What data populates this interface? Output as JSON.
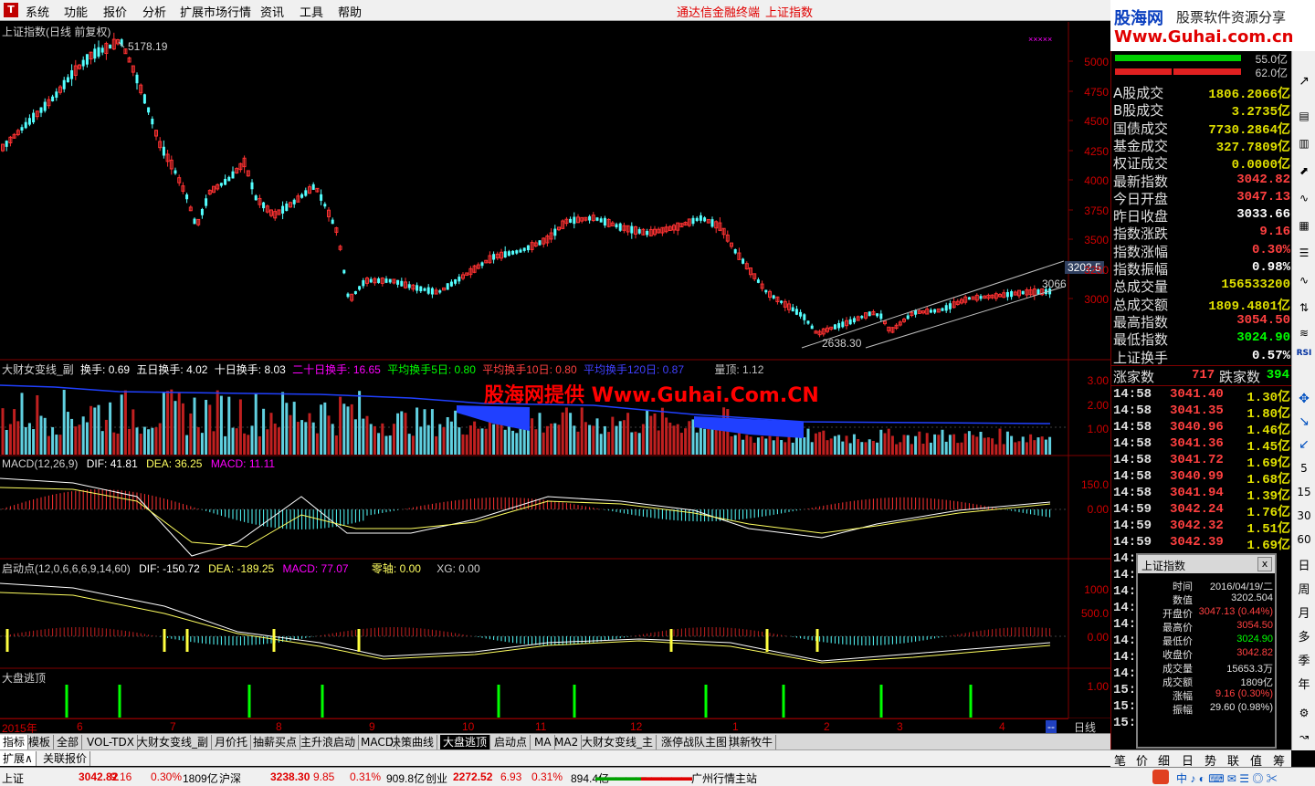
{
  "menu": {
    "logo": "T",
    "items": [
      "系统",
      "功能",
      "报价",
      "分析",
      "扩展市场行情",
      "资讯",
      "工具",
      "帮助"
    ],
    "title_terminal": "通达信金融终端",
    "title_index": "上证指数"
  },
  "brand": {
    "logo_text": "股海网",
    "slogan": "股票软件资源分享",
    "url": "Www.Guhai.com.cn"
  },
  "main_chart": {
    "title": "上证指数(日线 前复权)",
    "high_label": "5178.19",
    "low_label": "2638.30",
    "last_label": "3066",
    "cursor_price": "3202.5",
    "y_ticks": [
      "5000",
      "4750",
      "4500",
      "4250",
      "4000",
      "3750",
      "3500",
      "3250",
      "3000"
    ],
    "colors": {
      "up": "#ff3232",
      "down": "#54ffff",
      "channel": "#c0c0c0"
    }
  },
  "volume_panel": {
    "title": "大财女变线_副",
    "items": [
      {
        "label": "换手: 0.69",
        "color": "#ffffff"
      },
      {
        "label": "五日换手: 4.02",
        "color": "#ffffff"
      },
      {
        "label": "十日换手: 8.03",
        "color": "#ffffff"
      },
      {
        "label": "二十日换手: 16.65",
        "color": "#ff00ff"
      },
      {
        "label": "平均换手5日: 0.80",
        "color": "#00ff00"
      },
      {
        "label": "平均换手10日: 0.80",
        "color": "#ff4040"
      },
      {
        "label": "平均换手120日: 0.87",
        "color": "#4040ff"
      },
      {
        "label": "量顶: 1.12",
        "color": "#c0c0c0"
      }
    ],
    "y_ticks": [
      "3.00",
      "2.00",
      "1.00"
    ]
  },
  "watermark": "股海网提供 Www.Guhai.Com.CN",
  "macd_panel": {
    "title": "MACD(12,26,9)",
    "dif": "DIF: 41.81",
    "dea": "DEA: 36.25",
    "macd": "MACD: 11.11",
    "y_ticks": [
      "150.0",
      "0.00"
    ]
  },
  "qidong_panel": {
    "title": "启动点(12,0,6,6,6,9,14,60)",
    "dif": "DIF: -150.72",
    "dea": "DEA: -189.25",
    "macd": "MACD: 77.07",
    "zero": "零轴: 0.00",
    "xg": "XG: 0.00",
    "y_ticks": [
      "1000",
      "500.0",
      "0.00"
    ]
  },
  "escape_panel": {
    "title": "大盘逃顶",
    "y_ticks": [
      "1.00"
    ]
  },
  "x_axis": {
    "labels": [
      "2015年",
      "6",
      "7",
      "8",
      "9",
      "10",
      "11",
      "12",
      "1",
      "2",
      "3",
      "4"
    ],
    "corner": "--",
    "period_label": "日线"
  },
  "info_panel": {
    "bar_values": [
      "55.0亿",
      "62.0亿"
    ],
    "rows": [
      {
        "label": "A股成交",
        "value": "1806.2066亿",
        "color": "#e0e000"
      },
      {
        "label": "B股成交",
        "value": "3.2735亿",
        "color": "#e0e000"
      },
      {
        "label": "国债成交",
        "value": "7730.2864亿",
        "color": "#e0e000"
      },
      {
        "label": "基金成交",
        "value": "327.7809亿",
        "color": "#e0e000"
      },
      {
        "label": "权证成交",
        "value": "0.0000亿",
        "color": "#e0e000"
      },
      {
        "label": "最新指数",
        "value": "3042.82",
        "color": "#ff4040"
      },
      {
        "label": "今日开盘",
        "value": "3047.13",
        "color": "#ff4040"
      },
      {
        "label": "昨日收盘",
        "value": "3033.66",
        "color": "#ffffff"
      },
      {
        "label": "指数涨跌",
        "value": "9.16",
        "color": "#ff4040"
      },
      {
        "label": "指数涨幅",
        "value": "0.30%",
        "color": "#ff4040"
      },
      {
        "label": "指数振幅",
        "value": "0.98%",
        "color": "#ffffff"
      },
      {
        "label": "总成交量",
        "value": "156533200",
        "color": "#e0e000"
      },
      {
        "label": "总成交额",
        "value": "1809.4801亿",
        "color": "#e0e000"
      },
      {
        "label": "最高指数",
        "value": "3054.50",
        "color": "#ff4040"
      },
      {
        "label": "最低指数",
        "value": "3024.90",
        "color": "#00ff00"
      },
      {
        "label": "上证换手",
        "value": "0.57%",
        "color": "#ffffff"
      }
    ],
    "up_label": "涨家数",
    "up_count": "717",
    "down_label": "跌家数",
    "down_count": "394",
    "ticks": [
      {
        "time": "14:58",
        "price": "3041.40",
        "vol": "1.30亿"
      },
      {
        "time": "14:58",
        "price": "3041.35",
        "vol": "1.80亿"
      },
      {
        "time": "14:58",
        "price": "3040.96",
        "vol": "1.46亿"
      },
      {
        "time": "14:58",
        "price": "3041.36",
        "vol": "1.45亿"
      },
      {
        "time": "14:58",
        "price": "3041.72",
        "vol": "1.69亿"
      },
      {
        "time": "14:58",
        "price": "3040.99",
        "vol": "1.68亿"
      },
      {
        "time": "14:58",
        "price": "3041.94",
        "vol": "1.39亿"
      },
      {
        "time": "14:59",
        "price": "3042.24",
        "vol": "1.76亿"
      },
      {
        "time": "14:59",
        "price": "3042.32",
        "vol": "1.51亿"
      },
      {
        "time": "14:59",
        "price": "3042.39",
        "vol": "1.69亿"
      },
      {
        "time": "14:5",
        "price": "",
        "vol": ""
      },
      {
        "time": "14:5",
        "price": "",
        "vol": ""
      },
      {
        "time": "14:5",
        "price": "",
        "vol": ""
      },
      {
        "time": "14:5",
        "price": "",
        "vol": ""
      },
      {
        "time": "14:5",
        "price": "",
        "vol": ""
      },
      {
        "time": "14:5",
        "price": "",
        "vol": ""
      },
      {
        "time": "14:5",
        "price": "",
        "vol": ""
      },
      {
        "time": "14:5",
        "price": "",
        "vol": ""
      },
      {
        "time": "15:0",
        "price": "",
        "vol": ""
      },
      {
        "time": "15:0",
        "price": "",
        "vol": ""
      },
      {
        "time": "15:0",
        "price": "",
        "vol": ""
      }
    ],
    "bottom_tabs": [
      "笔",
      "价",
      "细",
      "日",
      "势",
      "联",
      "值",
      "筹"
    ]
  },
  "popup": {
    "title": "上证指数",
    "close": "x",
    "rows": [
      {
        "label": "时间",
        "value": "2016/04/19/二",
        "color": "#e0e0e0"
      },
      {
        "label": "数值",
        "value": "3202.504",
        "color": "#e0e0e0"
      },
      {
        "label": "开盘价",
        "value": "3047.13 (0.44%)",
        "color": "#ff4040"
      },
      {
        "label": "最高价",
        "value": "3054.50",
        "color": "#ff4040"
      },
      {
        "label": "最低价",
        "value": "3024.90",
        "color": "#00ff00"
      },
      {
        "label": "收盘价",
        "value": "3042.82",
        "color": "#ff4040"
      },
      {
        "label": "成交量",
        "value": "15653.3万",
        "color": "#e0e0e0"
      },
      {
        "label": "成交额",
        "value": "1809亿",
        "color": "#e0e0e0"
      },
      {
        "label": "涨幅",
        "value": "9.16 (0.30%)",
        "color": "#ff4040"
      },
      {
        "label": "振幅",
        "value": "29.60 (0.98%)",
        "color": "#e0e0e0"
      }
    ]
  },
  "side_toolbar": [
    "5",
    "15",
    "30",
    "60",
    "日",
    "周",
    "月",
    "多",
    "季",
    "年"
  ],
  "side_toolbar_top": [
    "RSI"
  ],
  "tabs": [
    "指标",
    "模板",
    "全部",
    "VOL-TDX",
    "大财女变线_副",
    "月价托",
    "抽薪买点",
    "主升浪启动",
    "MACD",
    "决策曲线",
    "大盘逃顶",
    "启动点",
    "MA",
    "MA2",
    "大财女变线_主",
    "涨停战队主图",
    "琪新牧牛"
  ],
  "tabs2": [
    "扩展∧",
    "关联报价"
  ],
  "status": {
    "items": [
      {
        "text": "上证",
        "color": "#000000"
      },
      {
        "text": "3042.82",
        "color": "#e00000"
      },
      {
        "text": "9.16",
        "color": "#e00000"
      },
      {
        "text": "0.30%",
        "color": "#e00000"
      },
      {
        "text": "1809亿",
        "color": "#000000"
      },
      {
        "text": "沪深",
        "color": "#000000"
      },
      {
        "text": "3238.30",
        "color": "#e00000"
      },
      {
        "text": "9.85",
        "color": "#e00000"
      },
      {
        "text": "0.31%",
        "color": "#e00000"
      },
      {
        "text": "909.8亿",
        "color": "#000000"
      },
      {
        "text": "创业",
        "color": "#000000"
      },
      {
        "text": "2272.52",
        "color": "#e00000"
      },
      {
        "text": "6.93",
        "color": "#e00000"
      },
      {
        "text": "0.31%",
        "color": "#e00000"
      },
      {
        "text": "894.4亿",
        "color": "#000000"
      }
    ],
    "server": "广州行情主站"
  }
}
